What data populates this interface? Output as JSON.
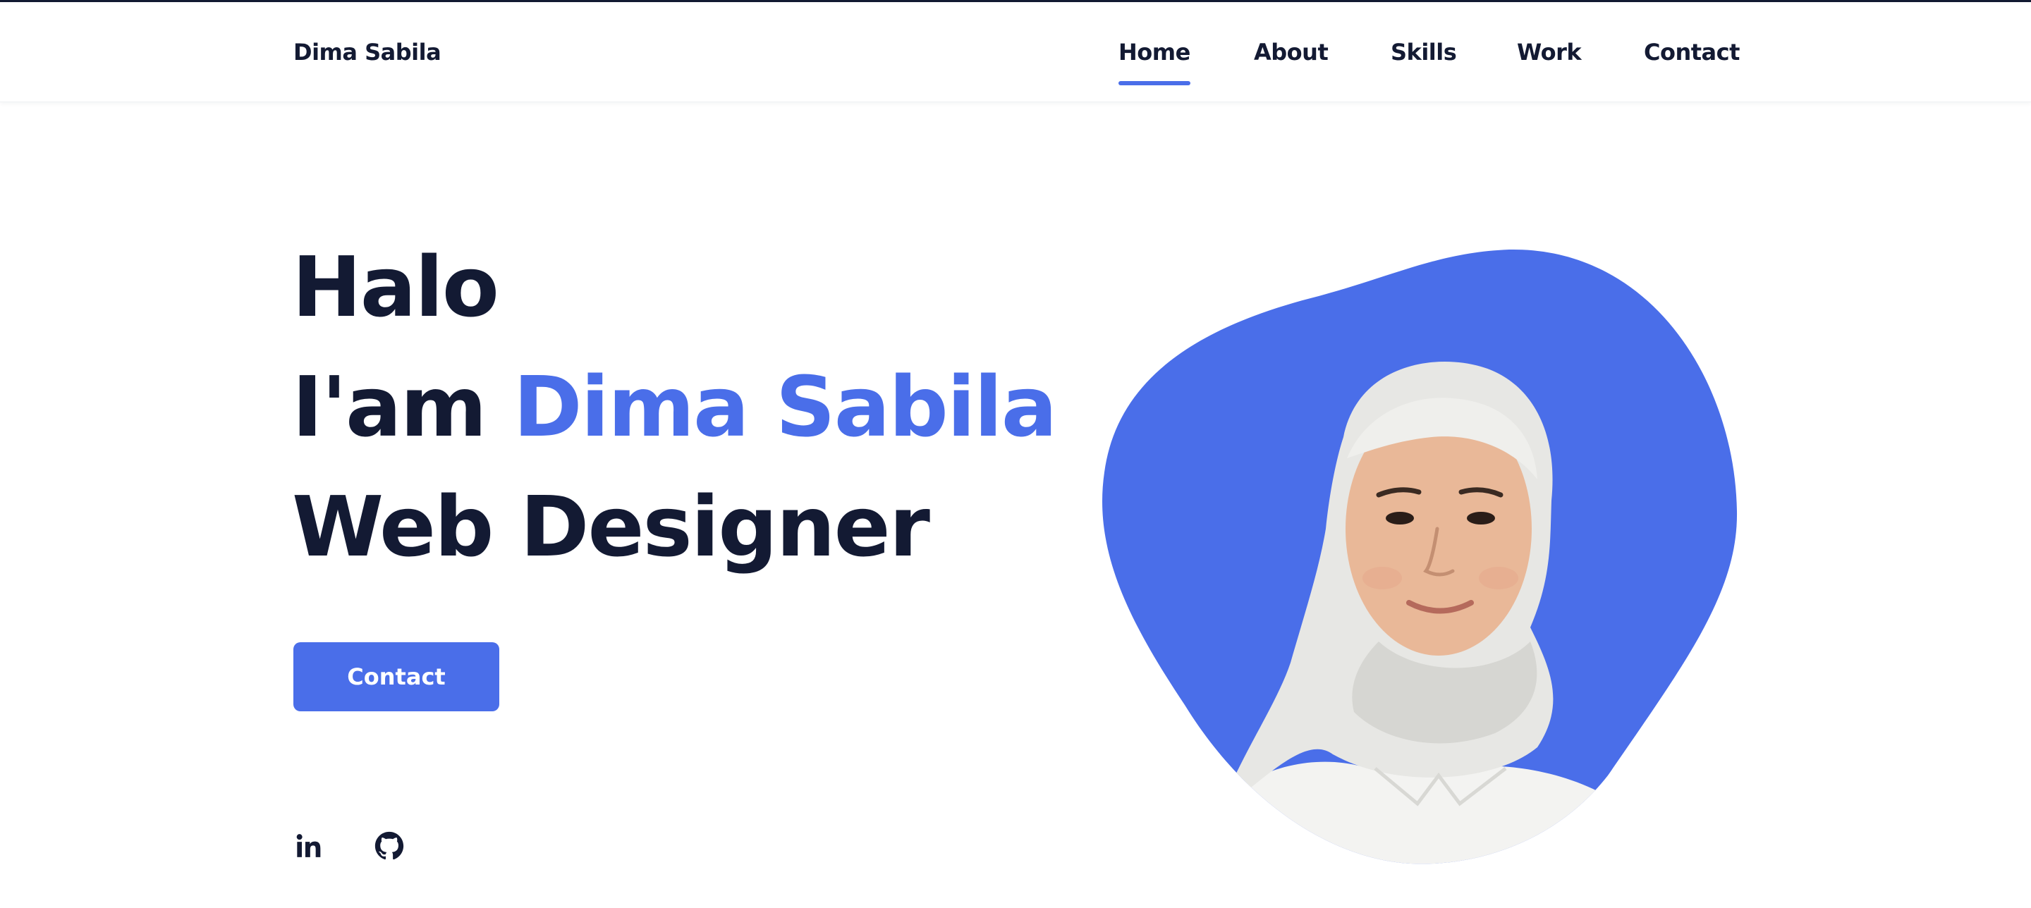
{
  "brand": "Dima Sabila",
  "nav": {
    "items": [
      {
        "label": "Home",
        "active": true
      },
      {
        "label": "About",
        "active": false
      },
      {
        "label": "Skills",
        "active": false
      },
      {
        "label": "Work",
        "active": false
      },
      {
        "label": "Contact",
        "active": false
      }
    ]
  },
  "hero": {
    "line1": "Halo",
    "line2_prefix": "I'am ",
    "line2_name": "Dima Sabila",
    "line3": "Web Designer",
    "button_label": "Contact"
  },
  "social": {
    "linkedin_icon": "linkedin-icon",
    "github_icon": "github-icon"
  },
  "colors": {
    "accent": "#4a6ee9",
    "text": "#131a33",
    "background": "#ffffff"
  }
}
